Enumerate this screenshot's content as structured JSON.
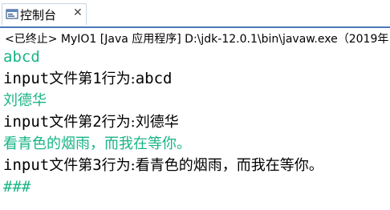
{
  "tab": {
    "label": "控制台",
    "close": "✕",
    "icon": "console-icon"
  },
  "status": "<已终止> MyIO1 [Java 应用程序] D:\\jdk-12.0.1\\bin\\javaw.exe（2019年",
  "colors": {
    "stdin_green": "#19b486",
    "stdout_black": "#000000",
    "tab_accent": "#4a7ab8"
  },
  "console": {
    "l1": "abcd",
    "l2_a": "input",
    "l2_b": "文件第",
    "l2_c": "1",
    "l2_d": "行为:",
    "l2_e": "abcd",
    "l3": "刘德华",
    "l4_a": "input",
    "l4_b": "文件第",
    "l4_c": "2",
    "l4_d": "行为:",
    "l4_e": "刘德华",
    "l5": "看青色的烟雨，而我在等你。",
    "l6_a": "input",
    "l6_b": "文件第",
    "l6_c": "3",
    "l6_d": "行为:",
    "l6_e": "看青色的烟雨，而我在等你。",
    "l7": "###"
  }
}
